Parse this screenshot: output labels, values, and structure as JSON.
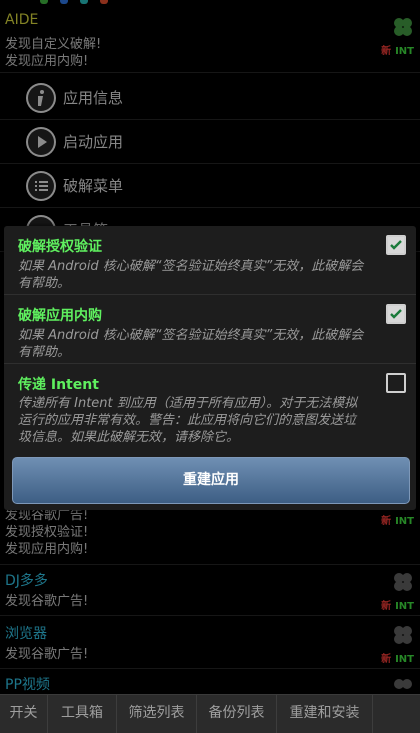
{
  "app_list": [
    {
      "name": "AIDE",
      "name_color": "#c9c93a",
      "lines": [
        "发现自定义破解!",
        "发现应用内购!"
      ],
      "tag_new": "新",
      "tag_int": "INT"
    },
    {
      "name": "发现谷歌广告!",
      "name_color": "#bbbbbb",
      "lines": [
        "发现授权验证!",
        "发现应用内购!"
      ],
      "tag_new": "新",
      "tag_int": "INT"
    },
    {
      "name": "DJ多多",
      "name_color": "#2fb6d6",
      "lines": [
        "发现谷歌广告!"
      ],
      "tag_new": "新",
      "tag_int": "INT"
    },
    {
      "name": "浏览器",
      "name_color": "#2fb6d6",
      "lines": [
        "发现谷歌广告!"
      ],
      "tag_new": "新",
      "tag_int": "INT"
    },
    {
      "name": "PP视频",
      "name_color": "#2fb6d6",
      "lines": [],
      "tag_new": "",
      "tag_int": ""
    }
  ],
  "context_menu": [
    {
      "label": "应用信息",
      "icon": "info-icon"
    },
    {
      "label": "启动应用",
      "icon": "play-icon"
    },
    {
      "label": "破解菜单",
      "icon": "list-icon"
    },
    {
      "label": "工具箱",
      "icon": "list-icon"
    }
  ],
  "dialog": {
    "options": [
      {
        "title": "破解授权验证",
        "desc": "如果 Android 核心破解“签名验证始终真实”无效，此破解会有帮助。",
        "checked": true
      },
      {
        "title": "破解应用内购",
        "desc": "如果 Android 核心破解“签名验证始终真实”无效，此破解会有帮助。",
        "checked": true
      },
      {
        "title": "传递 Intent",
        "desc": "传递所有 Intent 到应用（适用于所有应用）。对于无法模拟运行的应用非常有效。警告：此应用将向它们的意图发送垃圾信息。如果此破解无效，请移除它。",
        "checked": false
      }
    ],
    "rebuild_label": "重建应用"
  },
  "tabbar": [
    "开关",
    "工具箱",
    "筛选列表",
    "备份列表",
    "重建和安装"
  ],
  "colors": {
    "accent_green": "#5ff05f",
    "new_red": "#e53935",
    "int_green": "#3ccf3c",
    "button_blue": "#4f719a"
  }
}
